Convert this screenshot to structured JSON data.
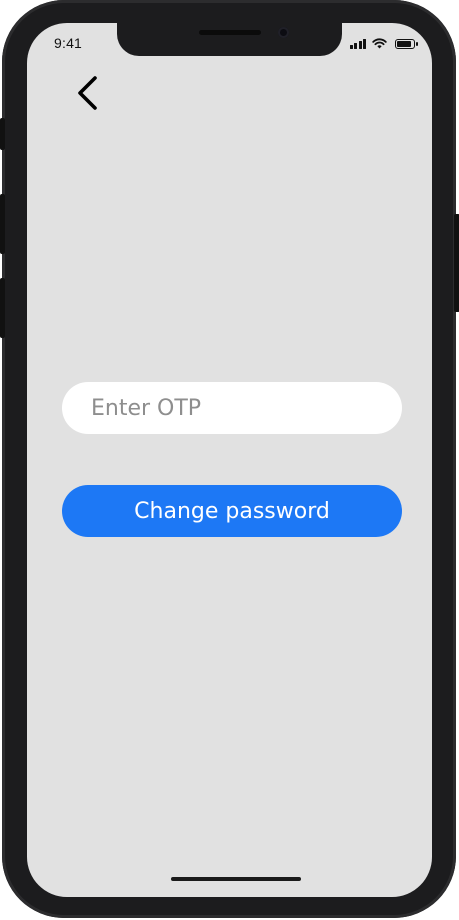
{
  "status_bar": {
    "time": "9:41",
    "signal_bars": 4,
    "battery_level": 0.85,
    "icons": [
      "cellular-signal-icon",
      "wifi-icon",
      "battery-icon"
    ]
  },
  "navigation": {
    "back_icon": "chevron-left-icon"
  },
  "form": {
    "otp_placeholder": "Enter OTP",
    "otp_value": "",
    "submit_label": "Change password"
  },
  "colors": {
    "background": "#e1e1e1",
    "input_background": "#ffffff",
    "primary_button": "#1d78f5",
    "button_text": "#ffffff",
    "placeholder_text": "#8e8e8e"
  }
}
